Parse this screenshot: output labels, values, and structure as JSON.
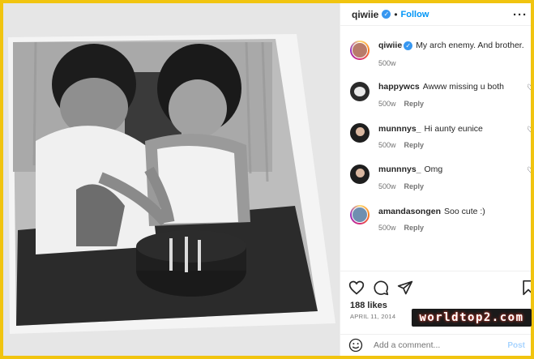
{
  "post": {
    "author": "qiwiie",
    "verified_mark": "✓",
    "separator": "•",
    "follow_label": "Follow",
    "more_label": "···"
  },
  "caption": {
    "username": "qiwiie",
    "text": "My arch enemy. And brother.",
    "age": "500w"
  },
  "comments": [
    {
      "username": "happywcs",
      "text": "Awww missing u both",
      "age": "500w",
      "reply_label": "Reply"
    },
    {
      "username": "munnnys_",
      "text": "Hi aunty eunice",
      "age": "500w",
      "reply_label": "Reply"
    },
    {
      "username": "munnnys_",
      "text": "Omg",
      "age": "500w",
      "reply_label": "Reply"
    },
    {
      "username": "amandasongen",
      "text": "Soo cute :)",
      "age": "500w",
      "reply_label": "Reply"
    }
  ],
  "actions": {
    "icons": [
      "heart-icon",
      "comment-icon",
      "share-icon",
      "bookmark-icon"
    ],
    "likes": "188 likes",
    "date": "APRIL 11, 2014"
  },
  "add_comment": {
    "placeholder": "Add a comment...",
    "post_label": "Post"
  },
  "watermark": "worldtop2.com",
  "colors": {
    "frame": "#f1c40f",
    "link_blue": "#0095f6",
    "verified_blue": "#3797f0",
    "muted": "#737373"
  }
}
